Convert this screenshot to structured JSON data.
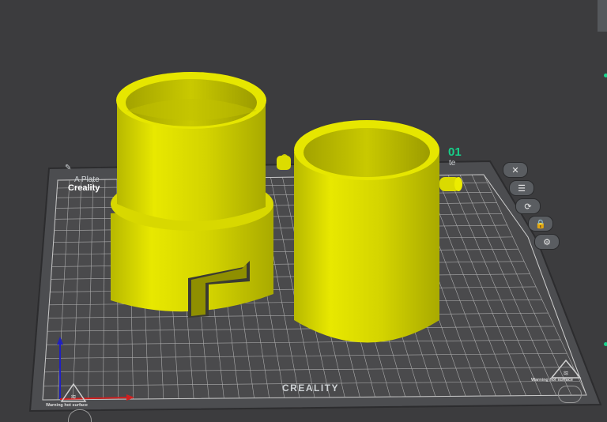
{
  "viewport": {
    "plate_tab_left": "A Plate",
    "plate_tab_right": "te",
    "plate_name": "Creality",
    "plate_number": "01",
    "brand_label": "CREALITY",
    "warning_left": "Warning hot surface",
    "warning_right": "Warning hot surface"
  },
  "plate_buttons": [
    {
      "name": "close-plate-button",
      "icon": "close-icon",
      "glyph": "✕"
    },
    {
      "name": "arrange-button",
      "icon": "list-icon",
      "glyph": "☰"
    },
    {
      "name": "orient-button",
      "icon": "orient-icon",
      "glyph": "⟳"
    },
    {
      "name": "lock-plate-button",
      "icon": "lock-icon",
      "glyph": "🔒"
    },
    {
      "name": "plate-settings-button",
      "icon": "gear-icon",
      "glyph": "⚙"
    }
  ],
  "colors": {
    "background": "#3c3c3e",
    "bed": "#4a4a4c",
    "grid": "#bdbdbd",
    "model": "#e8e800",
    "accent": "#19d38d"
  }
}
